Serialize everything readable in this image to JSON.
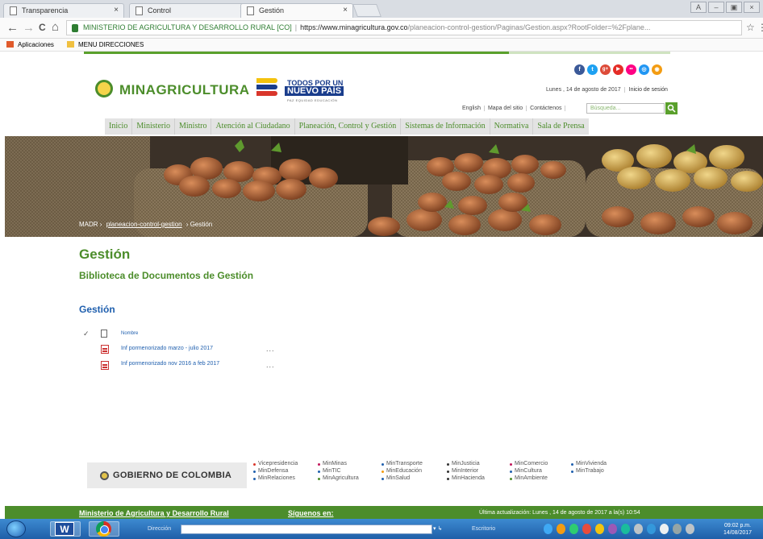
{
  "browser": {
    "tabs": [
      {
        "label": "Transparencia",
        "close": "×",
        "active": false
      },
      {
        "label": "Control",
        "close": "×",
        "active": false
      },
      {
        "label": "Gestión",
        "close": "×",
        "active": true
      }
    ],
    "window_buttons": [
      "A",
      "–",
      "▣",
      "×"
    ],
    "nav": {
      "back": "←",
      "forward": "→",
      "reload": "C",
      "home": "⌂"
    },
    "address": {
      "org": "MINISTERIO DE AGRICULTURA Y DESARROLLO RURAL [CO]",
      "separator": "|",
      "host": "https://www.minagricultura.gov.co",
      "path": "/planeacion-control-gestion/Paginas/Gestion.aspx?RootFolder=%2Fplane..."
    },
    "bookmark_star": "☆",
    "menu_dots": "⋮",
    "bookmarks": [
      {
        "label": "Aplicaciones",
        "icon": "apps-grid-icon",
        "color": "#e05a2b"
      },
      {
        "label": "MENU DIRECCIONES",
        "icon": "folder-icon",
        "color": "#f0c040"
      }
    ]
  },
  "site": {
    "logo_text": "MINAGRICULTURA",
    "campaign": {
      "line1": "TODOS POR UN",
      "line2": "NUEVO PAÍS",
      "line3": "PAZ  EQUIDAD  EDUCACIÓN"
    },
    "social": [
      {
        "icon": "facebook-icon",
        "glyph": "f",
        "color": "#3b5998"
      },
      {
        "icon": "twitter-icon",
        "glyph": "t",
        "color": "#1da1f2"
      },
      {
        "icon": "google-plus-icon",
        "glyph": "g+",
        "color": "#dd4b39"
      },
      {
        "icon": "youtube-icon",
        "glyph": "▶",
        "color": "#e52d27"
      },
      {
        "icon": "flickr-icon",
        "glyph": "••",
        "color": "#ff0084"
      },
      {
        "icon": "issuu-icon",
        "glyph": "◎",
        "color": "#2196f3"
      },
      {
        "icon": "rss-icon",
        "glyph": "◉",
        "color": "#f39c12"
      }
    ],
    "date": "Lunes , 14 de agosto de 2017",
    "login": "Inicio de sesión",
    "util_links": [
      "English",
      "Mapa del sitio",
      "Contáctenos"
    ],
    "search": {
      "placeholder": "Búsqueda...",
      "button_glyph": "🔍"
    },
    "menu": [
      "Inicio",
      "Ministerio",
      "Ministro",
      "Atención al Ciudadano",
      "Planeación, Control y Gestión",
      "Sistemas de Información",
      "Normativa",
      "Sala de Prensa"
    ],
    "breadcrumb": {
      "root": "MADR",
      "sep": "›",
      "section": "planeacion-control-gestion",
      "current": "Gestión"
    },
    "page_title": "Gestión",
    "page_subtitle": "Biblioteca de Documentos de Gestión",
    "section_title": "Gestión",
    "doc_header": {
      "check": "✓",
      "column": "Nombre"
    },
    "documents": [
      {
        "name": "Inf pormenorizado marzo - julio 2017",
        "menu": "..."
      },
      {
        "name": "Inf pormenorizado nov 2016 a feb 2017",
        "menu": "..."
      }
    ],
    "gobierno": "GOBIERNO DE COLOMBIA",
    "ministries": [
      {
        "label": "Vicepresidencia",
        "color": "#d9362b"
      },
      {
        "label": "MinDefensa",
        "color": "#1f5fae"
      },
      {
        "label": "MinRelaciones",
        "color": "#1f5fae"
      },
      {
        "label": "MinMinas",
        "color": "#c2185b"
      },
      {
        "label": "MinTIC",
        "color": "#1f5fae"
      },
      {
        "label": "MinAgricultura",
        "color": "#4c8d2b"
      },
      {
        "label": "MinTransporte",
        "color": "#1f5fae"
      },
      {
        "label": "MinEducación",
        "color": "#f39c12"
      },
      {
        "label": "MinSalud",
        "color": "#1f5fae"
      },
      {
        "label": "MinJusticia",
        "color": "#333333"
      },
      {
        "label": "MinInterior",
        "color": "#333333"
      },
      {
        "label": "MinHacienda",
        "color": "#333333"
      },
      {
        "label": "MinComercio",
        "color": "#c2185b"
      },
      {
        "label": "MinCultura",
        "color": "#1f5fae"
      },
      {
        "label": "MinAmbiente",
        "color": "#4c8d2b"
      },
      {
        "label": "MinVivienda",
        "color": "#1f5fae"
      },
      {
        "label": "MinTrabajo",
        "color": "#1f5fae"
      }
    ],
    "footer": {
      "title": "Ministerio de Agricultura y Desarrollo Rural",
      "follow": "Síguenos en:",
      "updated": "Última actualización: Lunes , 14 de agosto de 2017 a la(s) 10:54"
    }
  },
  "taskbar": {
    "word_glyph": "W",
    "direction_label": "Dirección",
    "direction_go": "▾ ↳",
    "desktop_label": "Escritorio",
    "clock_time": "09:02 p.m.",
    "clock_date": "14/08/2017"
  },
  "colors": {
    "brand_green": "#4c8d2b",
    "accent_blue": "#1f5fae",
    "link_red": "#c33"
  }
}
